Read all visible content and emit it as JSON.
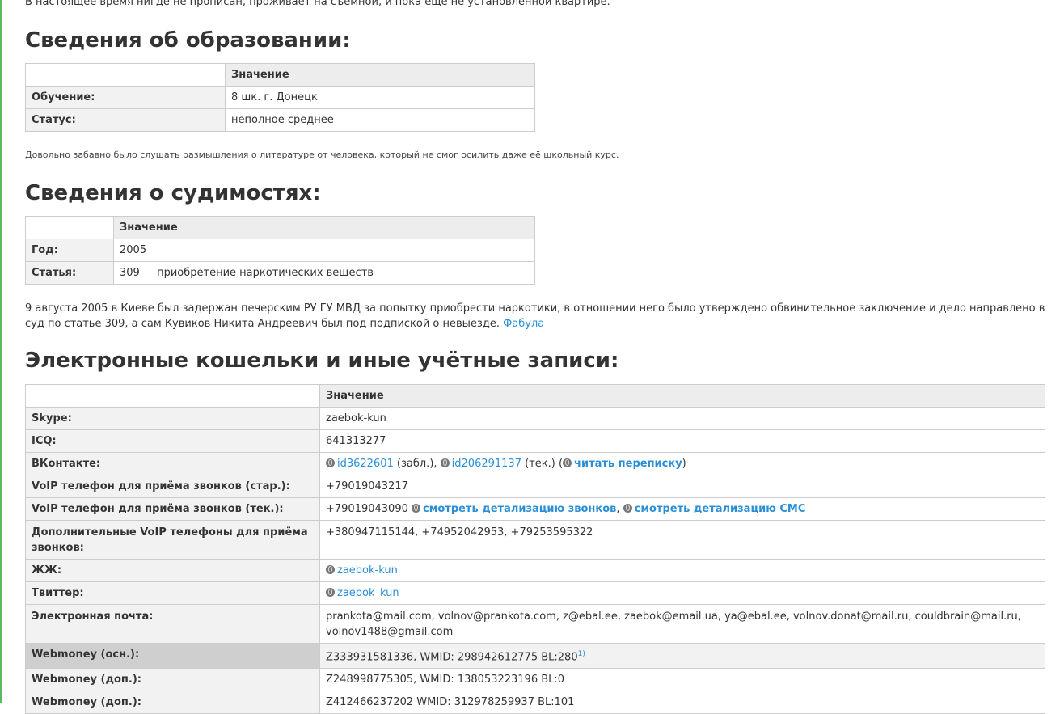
{
  "top_text": "В настоящее время нигде не прописан, проживает на съемной, и пока еще не установленной квартире.",
  "education": {
    "heading": "Сведения об образовании:",
    "value_header": "Значение",
    "rows": [
      {
        "key": "Обучение:",
        "value": "8 шк. г. Донецк"
      },
      {
        "key": "Статус:",
        "value": "неполное среднее"
      }
    ],
    "note": "Довольно забавно было слушать размышления о литературе от человека, который не смог осилить даже её школьный курс."
  },
  "convictions": {
    "heading": "Сведения о судимостях:",
    "value_header": "Значение",
    "rows": [
      {
        "key": "Год:",
        "value": "2005"
      },
      {
        "key": "Статья:",
        "value": "309 — приобретение наркотических веществ"
      }
    ],
    "paragraph": "9 августа 2005 в Киеве был задержан печерским РУ ГУ МВД за попытку приобрести наркотики, в отношении него было утверждено обвинительное заключение и дело направлено в суд по статье 309, а сам Кувиков Никита Андреевич был под подпиской о невыезде.",
    "paragraph_link": "Фабула"
  },
  "accounts": {
    "heading": "Электронные кошельки и иные учётные записи:",
    "value_header": "Значение",
    "skype": {
      "key": "Skype:",
      "value": "zaebok-kun"
    },
    "icq": {
      "key": "ICQ:",
      "value": "641313277"
    },
    "vk": {
      "key": "ВКонтакте:",
      "link1": "id3622601",
      "note1": "(забл.),",
      "link2": "id206291137",
      "note2": "(тек.) (",
      "link3": "читать переписку",
      "close": ")"
    },
    "voip_old": {
      "key": "VoIP телефон для приёма звонков (стар.):",
      "value": "+79019043217"
    },
    "voip_cur": {
      "key": "VoIP телефон для приёма звонков (тек.):",
      "value": "+79019043090",
      "link1": "смотреть детализацию звонков",
      "sep": ",",
      "link2": "смотреть детализацию СМС"
    },
    "voip_extra": {
      "key": "Дополнительные VoIP телефоны для приёма звонков:",
      "value": "+380947115144, +74952042953, +79253595322"
    },
    "lj": {
      "key": "ЖЖ:",
      "link": "zaebok-kun"
    },
    "twitter": {
      "key": "Твиттер:",
      "link": "zaebok_kun"
    },
    "email": {
      "key": "Электронная почта:",
      "value": "prankota@mail.com, volnov@prankota.com, z@ebal.ee, zaebok@email.ua, ya@ebal.ee, volnov.donat@mail.ru, couldbrain@mail.ru, volnov1488@gmail.com"
    },
    "wm_main": {
      "key": "Webmoney (осн.):",
      "value": "Z333931581336, WMID: 298942612775 BL:280",
      "footnote": "1)"
    },
    "wm_extra1": {
      "key": "Webmoney (доп.):",
      "value": "Z248998775305, WMID: 138053223196 BL:0"
    },
    "wm_extra2": {
      "key": "Webmoney (доп.):",
      "value": "Z412466237202 WMID: 312978259937 BL:101"
    }
  },
  "colors": {
    "accent": "#5cb85c",
    "link": "#2b8fd6"
  }
}
